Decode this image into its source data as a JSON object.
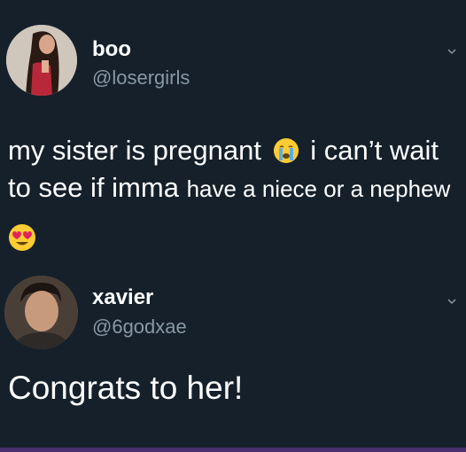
{
  "tweet1": {
    "display_name": "boo",
    "handle": "@losergirls",
    "text_part1": "my sister is pregnant",
    "emoji1": "crying-face",
    "text_part2": " i can’t wait",
    "text_line2_a": "to see if imma ",
    "text_line2_b": "have a niece or a nephew",
    "emoji2": "heart-eyes-face"
  },
  "tweet2": {
    "display_name": "xavier",
    "handle": "@6godxae",
    "text": "Congrats to her!"
  },
  "colors": {
    "background": "#15202b",
    "handle": "#8899a6",
    "emoji_yellow": "#ffcc33",
    "heart_red": "#e0245e"
  }
}
